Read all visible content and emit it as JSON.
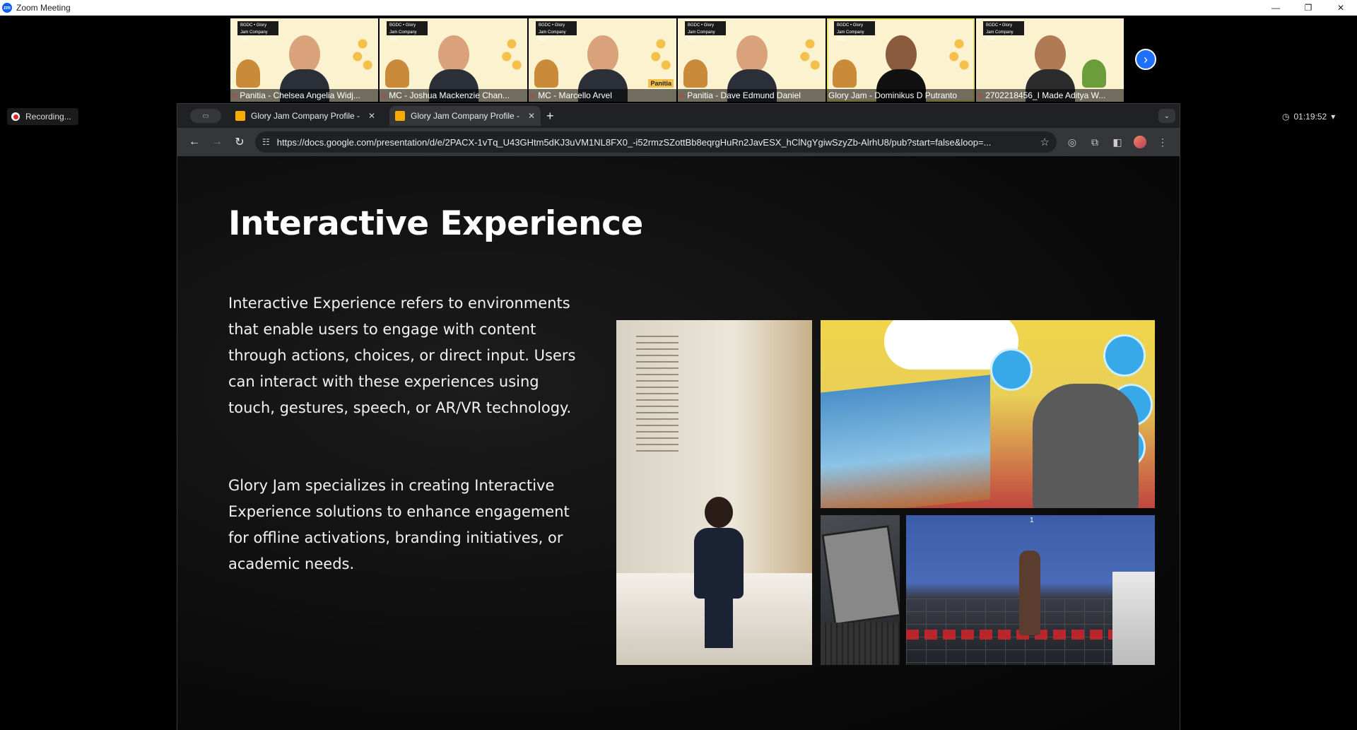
{
  "window": {
    "app_title": "Zoom Meeting",
    "logo_text": "zm",
    "minimize": "—",
    "restore": "❐",
    "close": "✕"
  },
  "participants": [
    {
      "name": "Panitia - Chelsea Angelia Widj...",
      "muted": true,
      "badge": "BGDC • Glory Jam Company Visit"
    },
    {
      "name": "MC - Joshua Mackenzie Chan...",
      "muted": true,
      "badge": "BGDC • Glory Jam Company Visit"
    },
    {
      "name": "MC - Marcello Arvel",
      "muted": true,
      "badge": "BGDC • Glory Jam Company Visit"
    },
    {
      "name": "Panitia - Dave Edmund Daniel",
      "muted": true,
      "badge": "BGDC • Glory Jam Company Visit"
    },
    {
      "name": "Glory Jam - Dominikus D Putranto",
      "muted": false,
      "badge": "BGDC • Glory Jam Company Visit"
    },
    {
      "name": "2702218456_I Made Aditya W...",
      "muted": true,
      "badge": "BGDC • Glory Jam Company Visit"
    }
  ],
  "gallery_next_icon": "›",
  "recording": {
    "label": "Recording..."
  },
  "timer": {
    "value": "01:19:52",
    "caret": "▾"
  },
  "browser": {
    "tabs": [
      {
        "title": "Glory Jam Company Profile -",
        "close": "✕"
      },
      {
        "title": "Glory Jam Company Profile -",
        "close": "✕"
      }
    ],
    "new_tab": "+",
    "tab_search": "▭",
    "tab_menu": "⌄",
    "back": "←",
    "forward": "→",
    "reload": "↻",
    "site_icon": "☷",
    "url": "https://docs.google.com/presentation/d/e/2PACX-1vTq_U43GHtm5dKJ3uVM1NL8FX0_-i52rmzSZottBb8eqrgHuRn2JavESX_hClNgYgiwSzyZb-AlrhU8/pub?start=false&loop=...",
    "star": "☆",
    "ext1": "◎",
    "ext2": "⧉",
    "sidepanel": "◧",
    "menu": "⋮"
  },
  "slide": {
    "title": "Interactive Experience",
    "paragraph1": "Interactive Experience refers to environments that enable users to engage with content through actions, choices, or direct input. Users can interact with these experiences using touch, gestures, speech, or AR/VR technology.",
    "paragraph2": "Glory Jam specializes in creating Interactive Experience solutions to enhance engagement for offline activations, branding initiatives, or academic needs.",
    "photo4_label": "1",
    "panitia_label": "Panitia"
  }
}
